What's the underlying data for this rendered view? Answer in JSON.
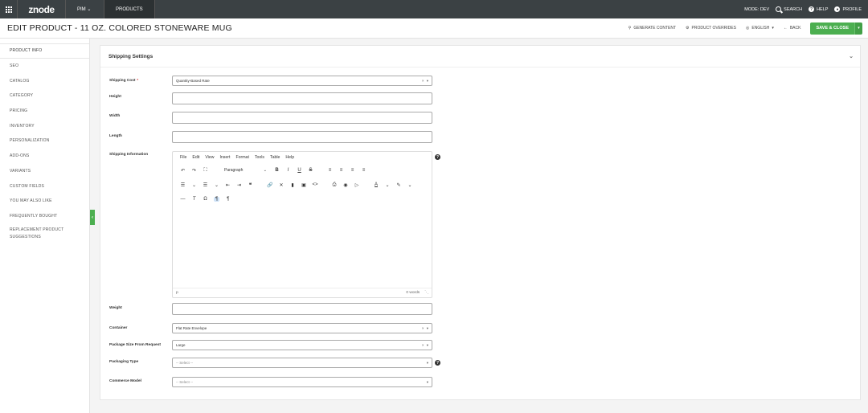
{
  "topnav": {
    "logo": "znode",
    "pim_label": "PIM",
    "products_label": "PRODUCTS",
    "mode_label": "MODE: DEV",
    "search_label": "SEARCH",
    "help_label": "HELP",
    "profile_label": "PROFILE"
  },
  "header": {
    "title": "EDIT PRODUCT - 11 OZ. COLORED STONEWARE MUG",
    "generate_content": "GENERATE CONTENT",
    "product_overrides": "PRODUCT OVERRIDES",
    "language": "ENGLISH",
    "back": "BACK",
    "save_close": "SAVE & CLOSE"
  },
  "sidebar": {
    "items": [
      {
        "label": "PRODUCT INFO"
      },
      {
        "label": "SEO"
      },
      {
        "label": "CATALOG"
      },
      {
        "label": "CATEGORY"
      },
      {
        "label": "PRICING"
      },
      {
        "label": "INVENTORY"
      },
      {
        "label": "PERSONALIZATION"
      },
      {
        "label": "ADD-ONS"
      },
      {
        "label": "VARIANTS"
      },
      {
        "label": "CUSTOM FIELDS"
      },
      {
        "label": "YOU MAY ALSO LIKE"
      },
      {
        "label": "FREQUENTLY BOUGHT"
      },
      {
        "label": "REPLACEMENT PRODUCT SUGGESTIONS"
      }
    ]
  },
  "panel": {
    "title": "Shipping Settings",
    "fields": {
      "shipping_cost": {
        "label": "Shipping Cost",
        "required_mark": "*",
        "value": "Quantity-Based Rate"
      },
      "height": {
        "label": "Height",
        "value": ""
      },
      "width": {
        "label": "Width",
        "value": ""
      },
      "length": {
        "label": "Length",
        "value": ""
      },
      "shipping_information": {
        "label": "Shipping Information"
      },
      "weight": {
        "label": "Weight",
        "value": ""
      },
      "container": {
        "label": "Container",
        "value": "Flat Rate Envelope"
      },
      "package_size": {
        "label": "Package Size From Request",
        "value": "Large"
      },
      "packaging_type": {
        "label": "Packaging Type",
        "placeholder": "-- Select --"
      },
      "commerce_model": {
        "label": "Commerce Model",
        "placeholder": "-- Select --"
      }
    },
    "editor": {
      "menu": [
        "File",
        "Edit",
        "View",
        "Insert",
        "Format",
        "Tools",
        "Table",
        "Help"
      ],
      "block_format": "Paragraph",
      "status_path": "p",
      "word_count": "0 words"
    }
  }
}
